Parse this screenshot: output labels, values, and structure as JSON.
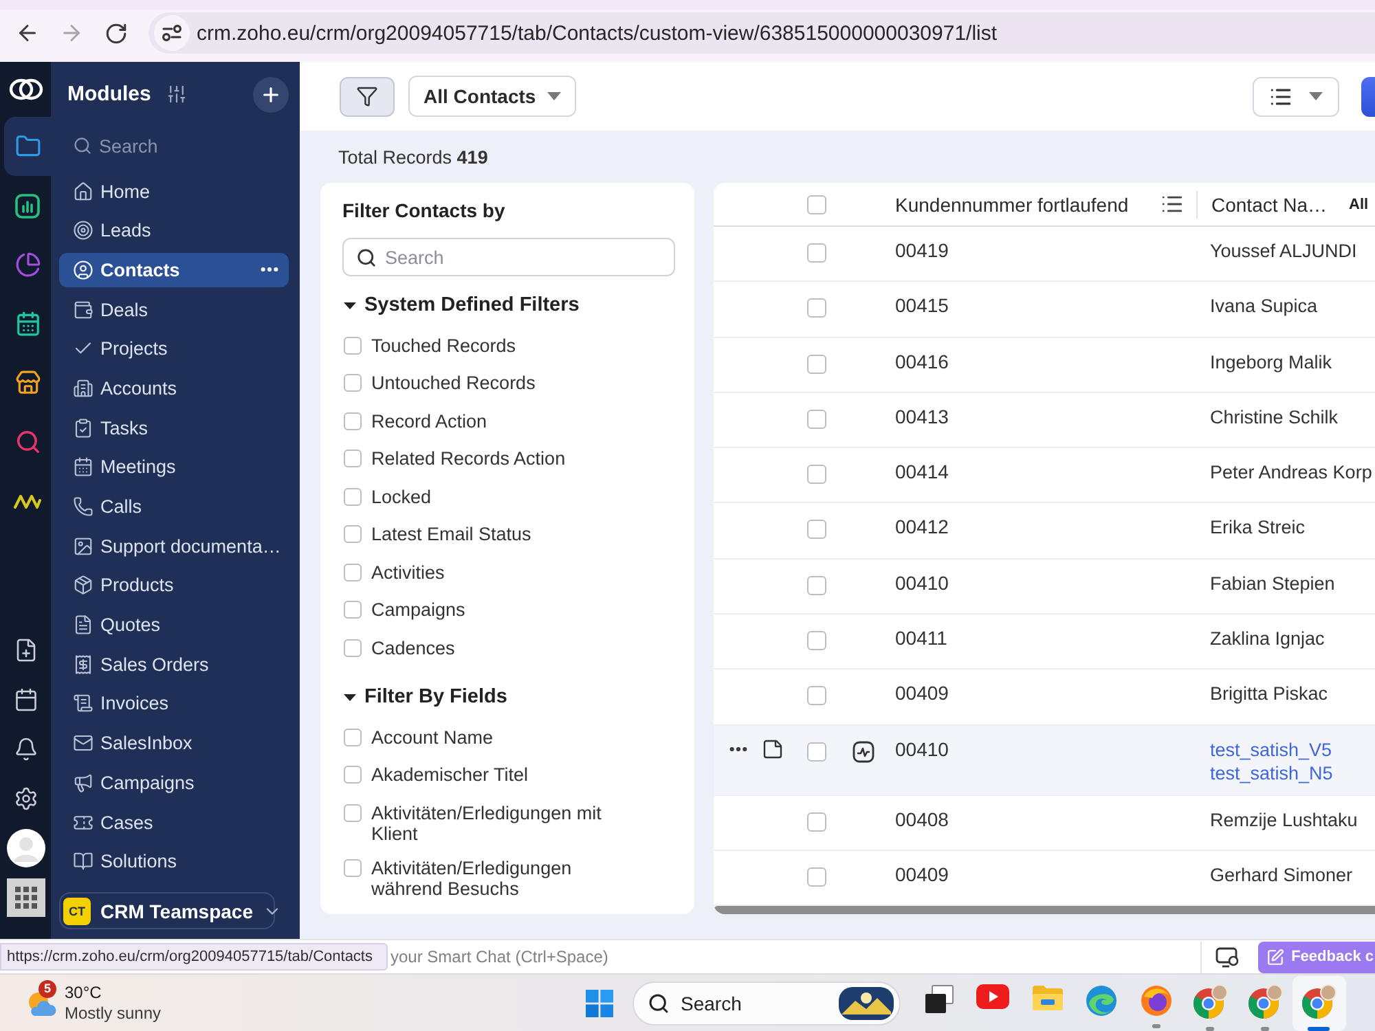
{
  "browser": {
    "url": "crm.zoho.eu/crm/org20094057715/tab/Contacts/custom-view/638515000000030971/list",
    "back_disabled": false,
    "forward_disabled": true
  },
  "rail": {
    "apps": [
      {
        "selected": true
      },
      {
        "selected": false
      },
      {
        "selected": false
      },
      {
        "selected": false
      },
      {
        "selected": false
      },
      {
        "selected": false
      },
      {
        "selected": false
      }
    ]
  },
  "sidebar": {
    "title": "Modules",
    "search": {
      "placeholder": "Search"
    },
    "items": [
      {
        "label": "Home",
        "selected": false
      },
      {
        "label": "Leads",
        "selected": false
      },
      {
        "label": "Contacts",
        "selected": true
      },
      {
        "label": "Deals",
        "selected": false
      },
      {
        "label": "Projects",
        "selected": false
      },
      {
        "label": "Accounts",
        "selected": false
      },
      {
        "label": "Tasks",
        "selected": false
      },
      {
        "label": "Meetings",
        "selected": false
      },
      {
        "label": "Calls",
        "selected": false
      },
      {
        "label": "Support documenta…",
        "selected": false
      },
      {
        "label": "Products",
        "selected": false
      },
      {
        "label": "Quotes",
        "selected": false
      },
      {
        "label": "Sales Orders",
        "selected": false
      },
      {
        "label": "Invoices",
        "selected": false
      },
      {
        "label": "SalesInbox",
        "selected": false
      },
      {
        "label": "Campaigns",
        "selected": false
      },
      {
        "label": "Cases",
        "selected": false
      },
      {
        "label": "Solutions",
        "selected": false
      }
    ],
    "teamspace": {
      "badge": "CT",
      "label": "CRM Teamspace"
    }
  },
  "toolbar": {
    "view": "All Contacts"
  },
  "total_records": "Total Records **419**",
  "filter_panel": {
    "title": "Filter Contacts by",
    "search": {
      "placeholder": "Search"
    },
    "groups": [
      {
        "title": "System Defined Filters",
        "expanded": true,
        "items": [
          {
            "label": "Touched Records",
            "checked": false
          },
          {
            "label": "Untouched Records",
            "checked": false
          },
          {
            "label": "Record Action",
            "checked": false
          },
          {
            "label": "Related Records Action",
            "checked": false
          },
          {
            "label": "Locked",
            "checked": false
          },
          {
            "label": "Latest Email Status",
            "checked": false
          },
          {
            "label": "Activities",
            "checked": false
          },
          {
            "label": "Campaigns",
            "checked": false
          },
          {
            "label": "Cadences",
            "checked": false
          }
        ]
      },
      {
        "title": "Filter By Fields",
        "expanded": true,
        "items": [
          {
            "label": "Account Name",
            "checked": false
          },
          {
            "label": "Akademischer Titel",
            "checked": false
          },
          {
            "label": "Aktivitäten/Erledigungen mit Klient",
            "checked": false
          },
          {
            "label": "Aktivitäten/Erledigungen während Besuchs",
            "checked": false
          }
        ]
      }
    ]
  },
  "table": {
    "select_all_checked": false,
    "columns": [
      "Kundennummer fortlaufend",
      "Contact Na…"
    ],
    "all_label": "All",
    "rows": [
      {
        "number": "00419",
        "names": [
          "Youssef ALJUNDI"
        ],
        "checked": false,
        "hovered": false
      },
      {
        "number": "00415",
        "names": [
          "Ivana Supica"
        ],
        "checked": false,
        "hovered": false
      },
      {
        "number": "00416",
        "names": [
          "Ingeborg Malik"
        ],
        "checked": false,
        "hovered": false
      },
      {
        "number": "00413",
        "names": [
          "Christine Schilk"
        ],
        "checked": false,
        "hovered": false
      },
      {
        "number": "00414",
        "names": [
          "Peter Andreas Korp"
        ],
        "checked": false,
        "hovered": false
      },
      {
        "number": "00412",
        "names": [
          "Erika Streic"
        ],
        "checked": false,
        "hovered": false
      },
      {
        "number": "00410",
        "names": [
          "Fabian Stepien"
        ],
        "checked": false,
        "hovered": false
      },
      {
        "number": "00411",
        "names": [
          "Zaklina Ignjac"
        ],
        "checked": false,
        "hovered": false
      },
      {
        "number": "00409",
        "names": [
          "Brigitta Piskac"
        ],
        "checked": false,
        "hovered": false
      },
      {
        "number": "00410",
        "names": [
          "test_satish_V5",
          "test_satish_N5"
        ],
        "checked": false,
        "hovered": true
      },
      {
        "number": "00408",
        "names": [
          "Remzije Lushtaku"
        ],
        "checked": false,
        "hovered": false
      },
      {
        "number": "00409",
        "names": [
          "Gerhard Simoner"
        ],
        "checked": false,
        "hovered": false
      }
    ]
  },
  "status_bar": {
    "link_preview": "https://crm.zoho.eu/crm/org20094057715/tab/Contacts",
    "chat_placeholder": "your Smart Chat (Ctrl+Space)",
    "feedback": "Feedback c"
  },
  "taskbar": {
    "weather": {
      "badge": "5",
      "temperature": "30°C",
      "condition": "Mostly sunny"
    },
    "search": {
      "placeholder": "Search"
    },
    "apps": [
      {
        "running": false,
        "active": false
      },
      {
        "running": false,
        "active": false
      },
      {
        "running": false,
        "active": false
      },
      {
        "running": false,
        "active": false
      },
      {
        "running": true,
        "active": false
      },
      {
        "running": true,
        "active": false
      },
      {
        "running": true,
        "active": false
      },
      {
        "running": true,
        "active": true
      }
    ]
  }
}
